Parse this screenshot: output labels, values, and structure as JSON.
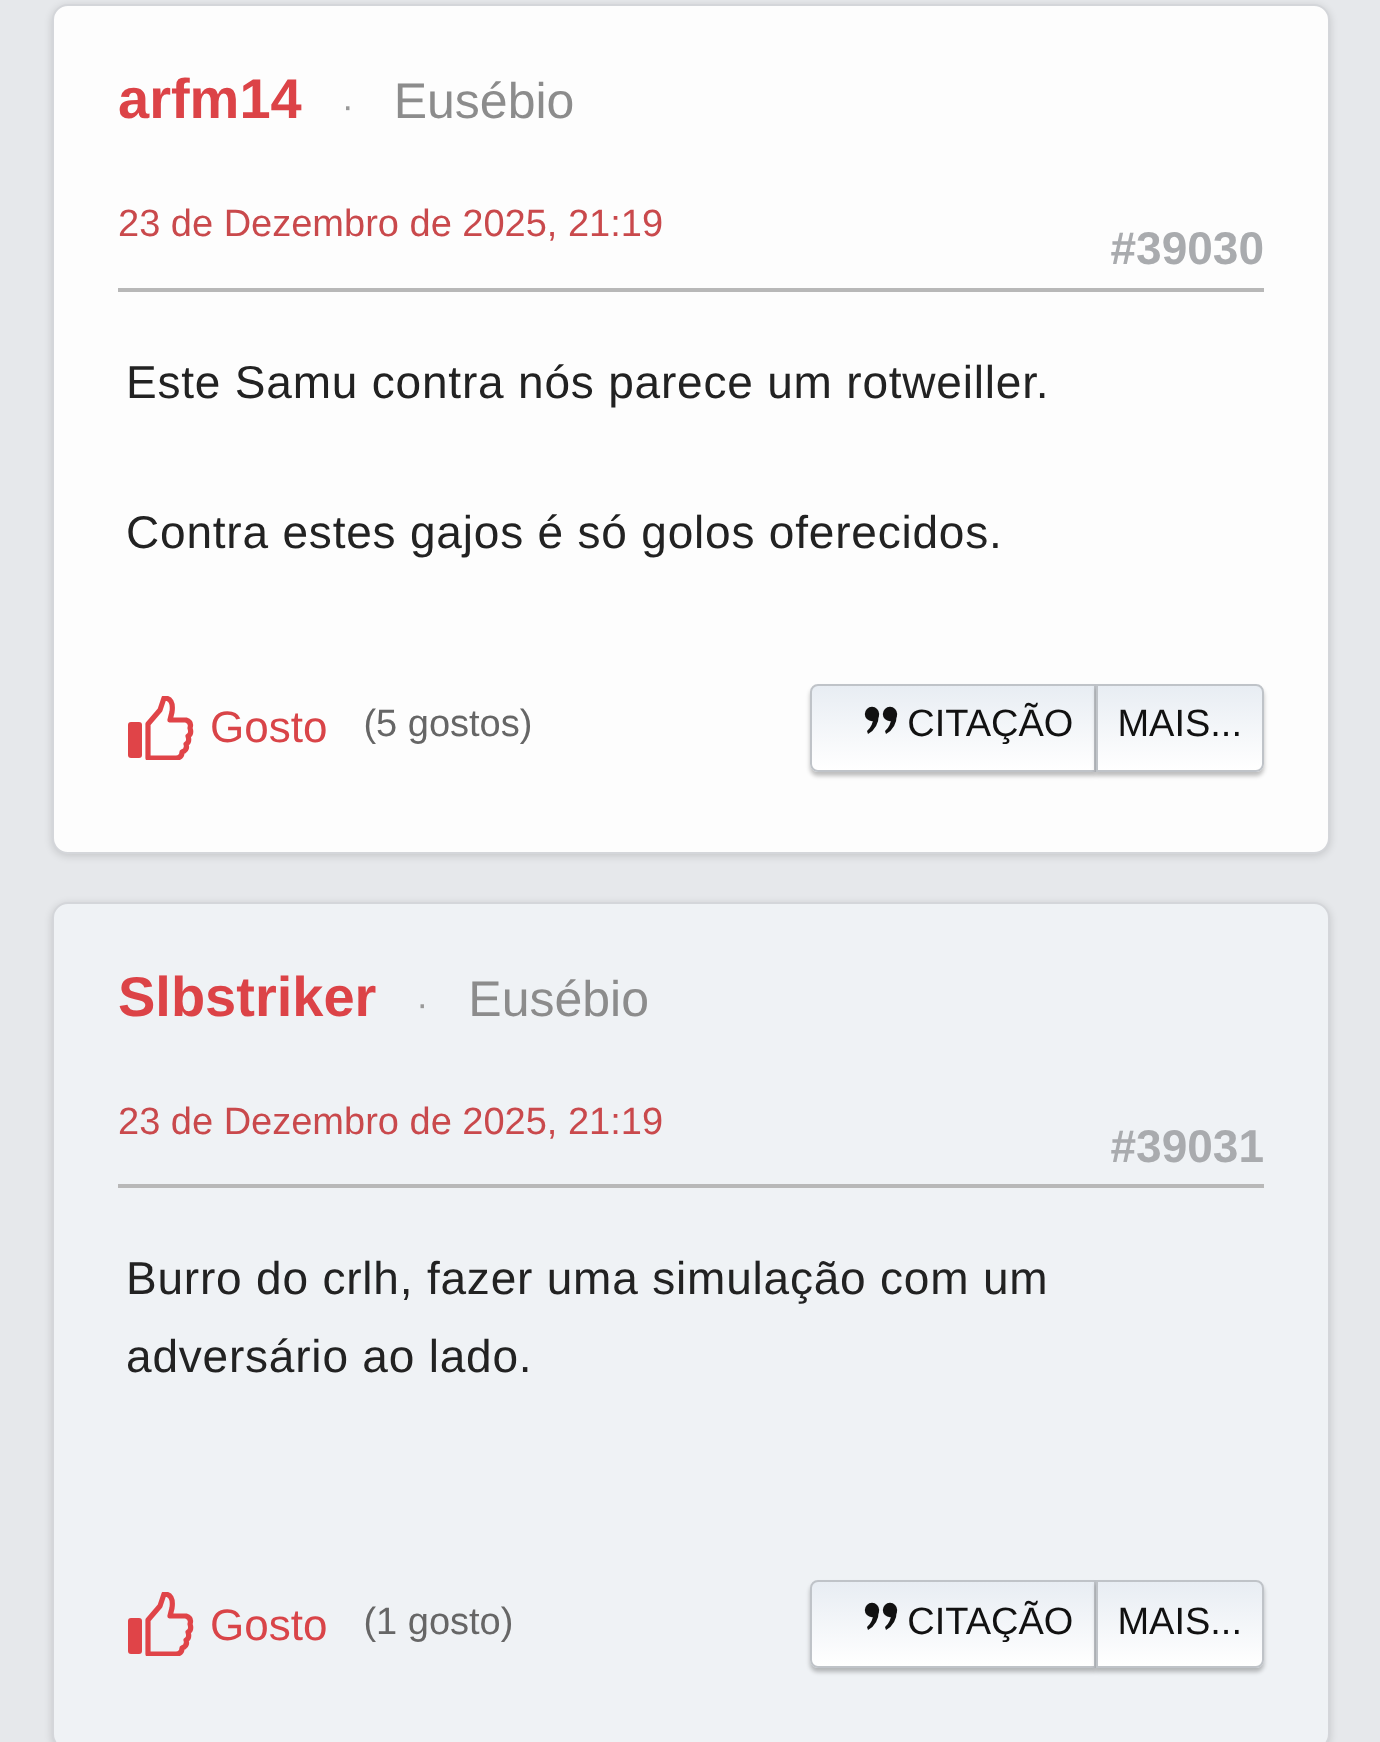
{
  "posts": [
    {
      "author": "arfm14",
      "separator": "·",
      "rank": "Eusébio",
      "date": "23 de Dezembro de 2025, 21:19",
      "number": "#39030",
      "highlighted": false,
      "paragraphs": [
        "Este Samu contra nós parece um rotweiller.",
        "Contra estes gajos é só golos oferecidos."
      ],
      "like_label": "Gosto",
      "like_count": "(5 gostos)",
      "buttons": [
        "CITAÇÃO",
        "MAIS..."
      ]
    },
    {
      "author": "Slbstriker",
      "separator": "·",
      "rank": "Eusébio",
      "date": "23 de Dezembro de 2025, 21:19",
      "number": "#39031",
      "highlighted": true,
      "paragraphs": [
        "Burro do crlh, fazer uma simulação com um adversário ao lado."
      ],
      "like_label": "Gosto",
      "like_count": "(1 gosto)",
      "buttons": [
        "CITAÇÃO",
        "MAIS..."
      ]
    }
  ]
}
